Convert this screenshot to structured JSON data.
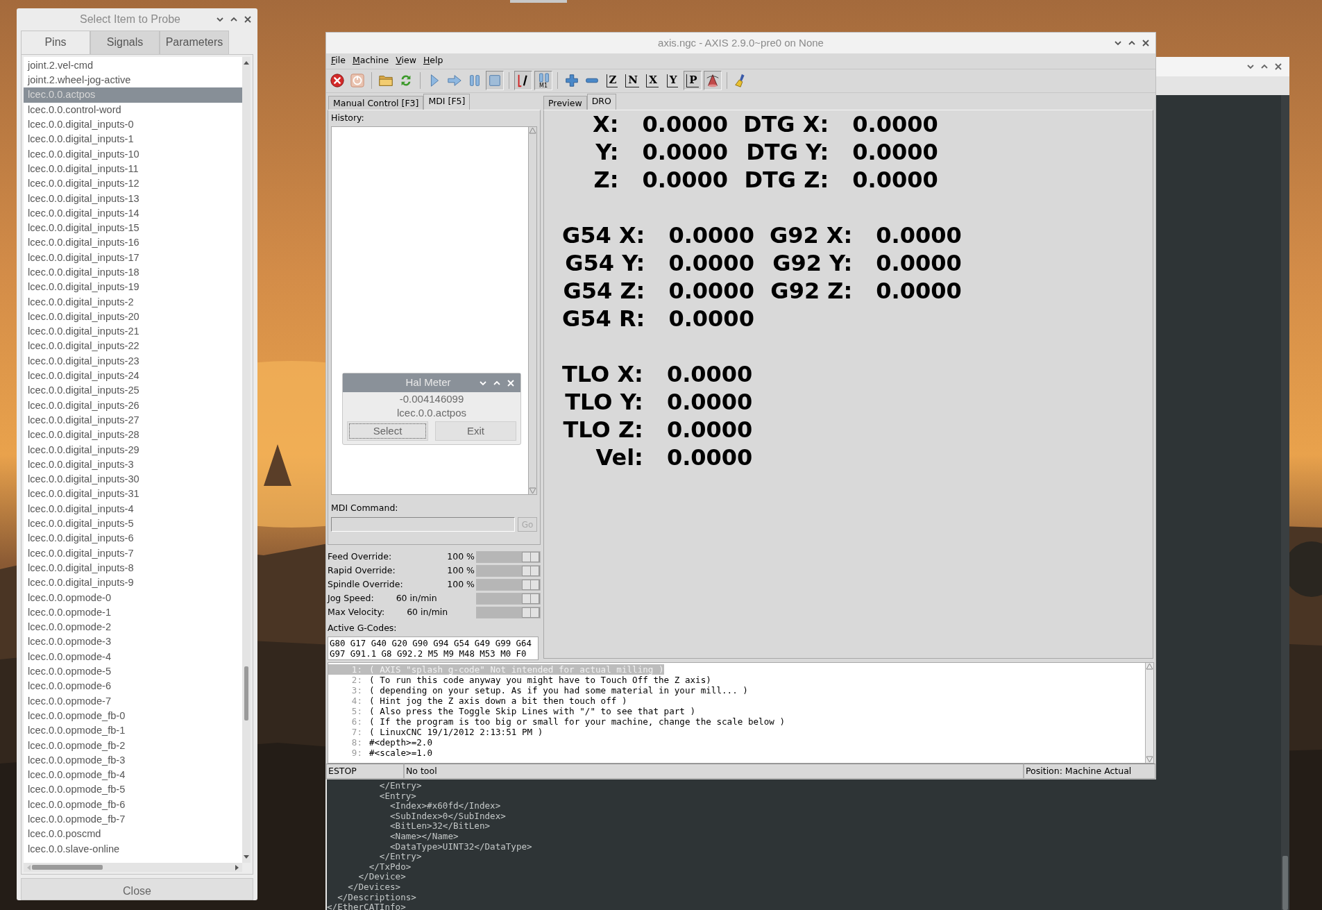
{
  "probe_window": {
    "title": "Select Item to Probe",
    "tabs": [
      {
        "label": "Pins",
        "selected": true
      },
      {
        "label": "Signals",
        "selected": false
      },
      {
        "label": "Parameters",
        "selected": false
      }
    ],
    "items": [
      {
        "label": "joint.2.vel-cmd",
        "selected": false
      },
      {
        "label": "joint.2.wheel-jog-active",
        "selected": false
      },
      {
        "label": "lcec.0.0.actpos",
        "selected": true
      },
      {
        "label": "lcec.0.0.control-word",
        "selected": false
      },
      {
        "label": "lcec.0.0.digital_inputs-0",
        "selected": false
      },
      {
        "label": "lcec.0.0.digital_inputs-1",
        "selected": false
      },
      {
        "label": "lcec.0.0.digital_inputs-10",
        "selected": false
      },
      {
        "label": "lcec.0.0.digital_inputs-11",
        "selected": false
      },
      {
        "label": "lcec.0.0.digital_inputs-12",
        "selected": false
      },
      {
        "label": "lcec.0.0.digital_inputs-13",
        "selected": false
      },
      {
        "label": "lcec.0.0.digital_inputs-14",
        "selected": false
      },
      {
        "label": "lcec.0.0.digital_inputs-15",
        "selected": false
      },
      {
        "label": "lcec.0.0.digital_inputs-16",
        "selected": false
      },
      {
        "label": "lcec.0.0.digital_inputs-17",
        "selected": false
      },
      {
        "label": "lcec.0.0.digital_inputs-18",
        "selected": false
      },
      {
        "label": "lcec.0.0.digital_inputs-19",
        "selected": false
      },
      {
        "label": "lcec.0.0.digital_inputs-2",
        "selected": false
      },
      {
        "label": "lcec.0.0.digital_inputs-20",
        "selected": false
      },
      {
        "label": "lcec.0.0.digital_inputs-21",
        "selected": false
      },
      {
        "label": "lcec.0.0.digital_inputs-22",
        "selected": false
      },
      {
        "label": "lcec.0.0.digital_inputs-23",
        "selected": false
      },
      {
        "label": "lcec.0.0.digital_inputs-24",
        "selected": false
      },
      {
        "label": "lcec.0.0.digital_inputs-25",
        "selected": false
      },
      {
        "label": "lcec.0.0.digital_inputs-26",
        "selected": false
      },
      {
        "label": "lcec.0.0.digital_inputs-27",
        "selected": false
      },
      {
        "label": "lcec.0.0.digital_inputs-28",
        "selected": false
      },
      {
        "label": "lcec.0.0.digital_inputs-29",
        "selected": false
      },
      {
        "label": "lcec.0.0.digital_inputs-3",
        "selected": false
      },
      {
        "label": "lcec.0.0.digital_inputs-30",
        "selected": false
      },
      {
        "label": "lcec.0.0.digital_inputs-31",
        "selected": false
      },
      {
        "label": "lcec.0.0.digital_inputs-4",
        "selected": false
      },
      {
        "label": "lcec.0.0.digital_inputs-5",
        "selected": false
      },
      {
        "label": "lcec.0.0.digital_inputs-6",
        "selected": false
      },
      {
        "label": "lcec.0.0.digital_inputs-7",
        "selected": false
      },
      {
        "label": "lcec.0.0.digital_inputs-8",
        "selected": false
      },
      {
        "label": "lcec.0.0.digital_inputs-9",
        "selected": false
      },
      {
        "label": "lcec.0.0.opmode-0",
        "selected": false
      },
      {
        "label": "lcec.0.0.opmode-1",
        "selected": false
      },
      {
        "label": "lcec.0.0.opmode-2",
        "selected": false
      },
      {
        "label": "lcec.0.0.opmode-3",
        "selected": false
      },
      {
        "label": "lcec.0.0.opmode-4",
        "selected": false
      },
      {
        "label": "lcec.0.0.opmode-5",
        "selected": false
      },
      {
        "label": "lcec.0.0.opmode-6",
        "selected": false
      },
      {
        "label": "lcec.0.0.opmode-7",
        "selected": false
      },
      {
        "label": "lcec.0.0.opmode_fb-0",
        "selected": false
      },
      {
        "label": "lcec.0.0.opmode_fb-1",
        "selected": false
      },
      {
        "label": "lcec.0.0.opmode_fb-2",
        "selected": false
      },
      {
        "label": "lcec.0.0.opmode_fb-3",
        "selected": false
      },
      {
        "label": "lcec.0.0.opmode_fb-4",
        "selected": false
      },
      {
        "label": "lcec.0.0.opmode_fb-5",
        "selected": false
      },
      {
        "label": "lcec.0.0.opmode_fb-6",
        "selected": false
      },
      {
        "label": "lcec.0.0.opmode_fb-7",
        "selected": false
      },
      {
        "label": "lcec.0.0.poscmd",
        "selected": false
      },
      {
        "label": "lcec.0.0.slave-online",
        "selected": false
      }
    ],
    "close_button": "Close"
  },
  "axis_window": {
    "title": "axis.ngc - AXIS 2.9.0~pre0 on None",
    "menu": [
      "File",
      "Machine",
      "View",
      "Help"
    ],
    "toolbar": [
      [
        {
          "kind": "estop",
          "pressed": false
        },
        {
          "kind": "power",
          "pressed": false
        }
      ],
      [
        {
          "kind": "open",
          "pressed": false
        },
        {
          "kind": "reload",
          "pressed": false
        }
      ],
      [
        {
          "kind": "run",
          "pressed": false
        },
        {
          "kind": "step",
          "pressed": false
        },
        {
          "kind": "pause",
          "pressed": false
        },
        {
          "kind": "stop",
          "pressed": true
        }
      ],
      [
        {
          "kind": "skip",
          "pressed": true
        },
        {
          "kind": "optional_stop",
          "pressed": true,
          "glyph": "M1"
        }
      ],
      [
        {
          "kind": "zoom_in",
          "pressed": false
        },
        {
          "kind": "zoom_out",
          "pressed": false
        },
        {
          "kind": "view",
          "pressed": false,
          "glyph": "Z"
        },
        {
          "kind": "view",
          "pressed": false,
          "glyph": "N"
        },
        {
          "kind": "view",
          "pressed": false,
          "glyph": "X"
        },
        {
          "kind": "view",
          "pressed": false,
          "glyph": "Y"
        },
        {
          "kind": "view",
          "pressed": true,
          "glyph": "P"
        },
        {
          "kind": "cone",
          "pressed": true
        }
      ],
      [
        {
          "kind": "clear",
          "pressed": false
        }
      ]
    ],
    "left_tabs": [
      {
        "label": "Manual Control [F3]",
        "selected": false
      },
      {
        "label": "MDI [F5]",
        "selected": true
      }
    ],
    "right_tabs": [
      {
        "label": "Preview",
        "selected": false
      },
      {
        "label": "DRO",
        "selected": true
      }
    ],
    "history_label": "History:",
    "mdi_label": "MDI Command:",
    "go_button": {
      "label": "Go",
      "disabled": true
    },
    "overrides": [
      {
        "kind": "percent",
        "label": "Feed Override:",
        "reading": "100 %",
        "level": 1
      },
      {
        "kind": "percent",
        "label": "Rapid Override:",
        "reading": "100 %",
        "level": 1
      },
      {
        "kind": "percent",
        "label": "Spindle Override:",
        "reading": "100 %",
        "level": 1
      },
      {
        "kind": "speed",
        "label": "Jog Speed:",
        "reading": "60 in/min",
        "level": 1
      },
      {
        "kind": "speed",
        "label": "Max Velocity:",
        "reading": "60 in/min",
        "level": 1
      }
    ],
    "active_gcodes_label": "Active G-Codes:",
    "active_gcodes": [
      "G80 G17 G40 G20 G90 G94 G54 G49 G99 G64",
      "G97 G91.1 G8 G92.2 M5 M9 M48 M53 M0 F0"
    ],
    "dro": [
      [
        [
          "X:",
          "0.0000",
          "DTG X:",
          "0.0000"
        ],
        [
          "Y:",
          "0.0000",
          "DTG Y:",
          "0.0000"
        ],
        [
          "Z:",
          "0.0000",
          "DTG Z:",
          "0.0000"
        ]
      ],
      [
        [
          "G54 X:",
          "0.0000",
          "G92 X:",
          "0.0000"
        ],
        [
          "G54 Y:",
          "0.0000",
          "G92 Y:",
          "0.0000"
        ],
        [
          "G54 Z:",
          "0.0000",
          "G92 Z:",
          "0.0000"
        ],
        [
          "G54 R:",
          "0.0000"
        ]
      ],
      [
        [
          "TLO X:",
          "0.0000"
        ],
        [
          "TLO Y:",
          "0.0000"
        ],
        [
          "TLO Z:",
          "0.0000"
        ],
        [
          "Vel:",
          "0.0000"
        ]
      ]
    ],
    "code_lines": [
      {
        "number": "1:",
        "text": "( AXIS \"splash g-code\" Not intended for actual milling )",
        "selected": true
      },
      {
        "number": "2:",
        "text": "( To run this code anyway you might have to Touch Off the Z axis)",
        "selected": false
      },
      {
        "number": "3:",
        "text": "( depending on your setup. As if you had some material in your mill... )",
        "selected": false
      },
      {
        "number": "4:",
        "text": "( Hint jog the Z axis down a bit then touch off )",
        "selected": false
      },
      {
        "number": "5:",
        "text": "( Also press the Toggle Skip Lines with \"/\" to see that part )",
        "selected": false
      },
      {
        "number": "6:",
        "text": "( If the program is too big or small for your machine, change the scale below )",
        "selected": false
      },
      {
        "number": "7:",
        "text": "( LinuxCNC 19/1/2012 2:13:51 PM )",
        "selected": false
      },
      {
        "number": "8:",
        "text": "#<depth>=2.0",
        "selected": false
      },
      {
        "number": "9:",
        "text": "#<scale>=1.0",
        "selected": false
      }
    ],
    "status": [
      "ESTOP",
      "No tool",
      "Position: Machine Actual"
    ]
  },
  "hal_meter": {
    "title": "Hal Meter",
    "value": "-0.004146099",
    "pin": "lcec.0.0.actpos",
    "buttons": [
      {
        "label": "Select",
        "focused": true
      },
      {
        "label": "Exit",
        "focused": false
      }
    ]
  },
  "xml_lines": [
    "          </Entry>",
    "          <Entry>",
    "            <Index>#x60fd</Index>",
    "            <SubIndex>0</SubIndex>",
    "            <BitLen>32</BitLen>",
    "            <Name></Name>",
    "            <DataType>UINT32</DataType>",
    "          </Entry>",
    "        </TxPdo>",
    "      </Device>",
    "    </Devices>",
    "  </Descriptions>",
    "</EtherCATInfo>"
  ]
}
